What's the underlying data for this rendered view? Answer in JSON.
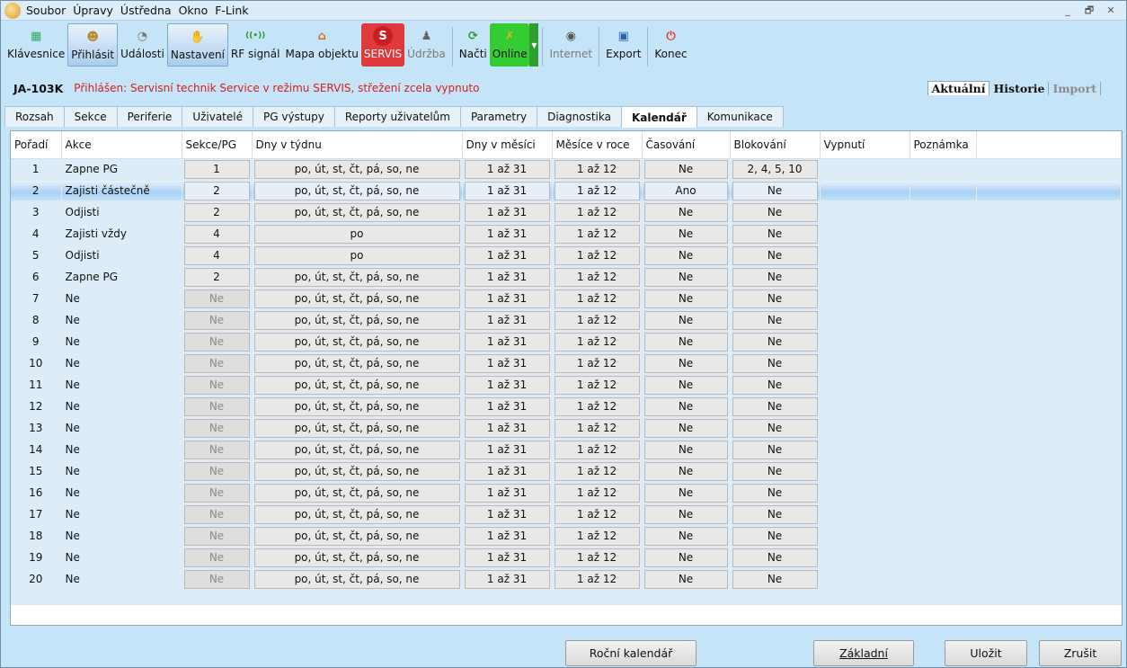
{
  "menu": [
    "Soubor",
    "Úpravy",
    "Ústředna",
    "Okno",
    "F-Link"
  ],
  "window_controls": [
    "_",
    "🗗",
    "✕"
  ],
  "toolbar": [
    {
      "label": "Klávesnice",
      "icon": "keypad-icon",
      "state": "normal"
    },
    {
      "label": "Přihlásit",
      "icon": "users-icon",
      "state": "active"
    },
    {
      "label": "Události",
      "icon": "events-icon",
      "state": "normal"
    },
    {
      "label": "Nastavení",
      "icon": "settings-hand-icon",
      "state": "active"
    },
    {
      "label": "RF signál",
      "icon": "rf-signal-icon",
      "state": "normal"
    },
    {
      "label": "Mapa objektu",
      "icon": "house-map-icon",
      "state": "normal"
    },
    {
      "label": "SERVIS",
      "icon": "service-icon",
      "state": "red"
    },
    {
      "label": "Údržba",
      "icon": "maintenance-icon",
      "state": "disabled"
    },
    {
      "label": "Načti",
      "icon": "reload-icon",
      "state": "normal"
    },
    {
      "label": "Online",
      "icon": "online-icon",
      "state": "green"
    },
    {
      "label": "Internet",
      "icon": "globe-icon",
      "state": "disabled"
    },
    {
      "label": "Export",
      "icon": "save-icon",
      "state": "normal"
    },
    {
      "label": "Konec",
      "icon": "power-icon",
      "state": "normal"
    }
  ],
  "status": {
    "device": "JA-103K",
    "message": "Přihlášen: Servisní technik Service v režimu SERVIS, střežení zcela vypnuto"
  },
  "mode_tabs": [
    "Aktuální",
    "Historie",
    "Import"
  ],
  "tabs": [
    "Rozsah",
    "Sekce",
    "Periferie",
    "Uživatelé",
    "PG výstupy",
    "Reporty uživatelům",
    "Parametry",
    "Diagnostika",
    "Kalendář",
    "Komunikace"
  ],
  "selected_tab": "Kalendář",
  "columns": [
    "Pořadí",
    "Akce",
    "Sekce/PG",
    "Dny v týdnu",
    "Dny v měsíci",
    "Měsíce v roce",
    "Časování",
    "Blokování",
    "Vypnutí",
    "Poznámka"
  ],
  "rows": [
    {
      "n": "1",
      "akce": "Zapne PG",
      "sekce": "1",
      "dny": "po, út, st, čt, pá, so, ne",
      "mesic": "1 až 31",
      "roky": "1 až 12",
      "cas": "Ne",
      "blok": "2, 4, 5, 10",
      "dim": false
    },
    {
      "n": "2",
      "akce": "Zajisti částečně",
      "sekce": "2",
      "dny": "po, út, st, čt, pá, so, ne",
      "mesic": "1 až 31",
      "roky": "1 až 12",
      "cas": "Ano",
      "blok": "Ne",
      "dim": false
    },
    {
      "n": "3",
      "akce": "Odjisti",
      "sekce": "2",
      "dny": "po, út, st, čt, pá, so, ne",
      "mesic": "1 až 31",
      "roky": "1 až 12",
      "cas": "Ne",
      "blok": "Ne",
      "dim": false
    },
    {
      "n": "4",
      "akce": "Zajisti vždy",
      "sekce": "4",
      "dny": "po",
      "mesic": "1 až 31",
      "roky": "1 až 12",
      "cas": "Ne",
      "blok": "Ne",
      "dim": false
    },
    {
      "n": "5",
      "akce": "Odjisti",
      "sekce": "4",
      "dny": "po",
      "mesic": "1 až 31",
      "roky": "1 až 12",
      "cas": "Ne",
      "blok": "Ne",
      "dim": false
    },
    {
      "n": "6",
      "akce": "Zapne PG",
      "sekce": "2",
      "dny": "po, út, st, čt, pá, so, ne",
      "mesic": "1 až 31",
      "roky": "1 až 12",
      "cas": "Ne",
      "blok": "Ne",
      "dim": false
    },
    {
      "n": "7",
      "akce": "Ne",
      "sekce": "Ne",
      "dny": "po, út, st, čt, pá, so, ne",
      "mesic": "1 až 31",
      "roky": "1 až 12",
      "cas": "Ne",
      "blok": "Ne",
      "dim": true
    },
    {
      "n": "8",
      "akce": "Ne",
      "sekce": "Ne",
      "dny": "po, út, st, čt, pá, so, ne",
      "mesic": "1 až 31",
      "roky": "1 až 12",
      "cas": "Ne",
      "blok": "Ne",
      "dim": true
    },
    {
      "n": "9",
      "akce": "Ne",
      "sekce": "Ne",
      "dny": "po, út, st, čt, pá, so, ne",
      "mesic": "1 až 31",
      "roky": "1 až 12",
      "cas": "Ne",
      "blok": "Ne",
      "dim": true
    },
    {
      "n": "10",
      "akce": "Ne",
      "sekce": "Ne",
      "dny": "po, út, st, čt, pá, so, ne",
      "mesic": "1 až 31",
      "roky": "1 až 12",
      "cas": "Ne",
      "blok": "Ne",
      "dim": true
    },
    {
      "n": "11",
      "akce": "Ne",
      "sekce": "Ne",
      "dny": "po, út, st, čt, pá, so, ne",
      "mesic": "1 až 31",
      "roky": "1 až 12",
      "cas": "Ne",
      "blok": "Ne",
      "dim": true
    },
    {
      "n": "12",
      "akce": "Ne",
      "sekce": "Ne",
      "dny": "po, út, st, čt, pá, so, ne",
      "mesic": "1 až 31",
      "roky": "1 až 12",
      "cas": "Ne",
      "blok": "Ne",
      "dim": true
    },
    {
      "n": "13",
      "akce": "Ne",
      "sekce": "Ne",
      "dny": "po, út, st, čt, pá, so, ne",
      "mesic": "1 až 31",
      "roky": "1 až 12",
      "cas": "Ne",
      "blok": "Ne",
      "dim": true
    },
    {
      "n": "14",
      "akce": "Ne",
      "sekce": "Ne",
      "dny": "po, út, st, čt, pá, so, ne",
      "mesic": "1 až 31",
      "roky": "1 až 12",
      "cas": "Ne",
      "blok": "Ne",
      "dim": true
    },
    {
      "n": "15",
      "akce": "Ne",
      "sekce": "Ne",
      "dny": "po, út, st, čt, pá, so, ne",
      "mesic": "1 až 31",
      "roky": "1 až 12",
      "cas": "Ne",
      "blok": "Ne",
      "dim": true
    },
    {
      "n": "16",
      "akce": "Ne",
      "sekce": "Ne",
      "dny": "po, út, st, čt, pá, so, ne",
      "mesic": "1 až 31",
      "roky": "1 až 12",
      "cas": "Ne",
      "blok": "Ne",
      "dim": true
    },
    {
      "n": "17",
      "akce": "Ne",
      "sekce": "Ne",
      "dny": "po, út, st, čt, pá, so, ne",
      "mesic": "1 až 31",
      "roky": "1 až 12",
      "cas": "Ne",
      "blok": "Ne",
      "dim": true
    },
    {
      "n": "18",
      "akce": "Ne",
      "sekce": "Ne",
      "dny": "po, út, st, čt, pá, so, ne",
      "mesic": "1 až 31",
      "roky": "1 až 12",
      "cas": "Ne",
      "blok": "Ne",
      "dim": true
    },
    {
      "n": "19",
      "akce": "Ne",
      "sekce": "Ne",
      "dny": "po, út, st, čt, pá, so, ne",
      "mesic": "1 až 31",
      "roky": "1 až 12",
      "cas": "Ne",
      "blok": "Ne",
      "dim": true
    },
    {
      "n": "20",
      "akce": "Ne",
      "sekce": "Ne",
      "dny": "po, út, st, čt, pá, so, ne",
      "mesic": "1 až 31",
      "roky": "1 až 12",
      "cas": "Ne",
      "blok": "Ne",
      "dim": true
    }
  ],
  "selected_row": "2",
  "buttons": {
    "annual": "Roční kalendář",
    "basic": "Základní",
    "save": "Uložit",
    "cancel": "Zrušit"
  }
}
